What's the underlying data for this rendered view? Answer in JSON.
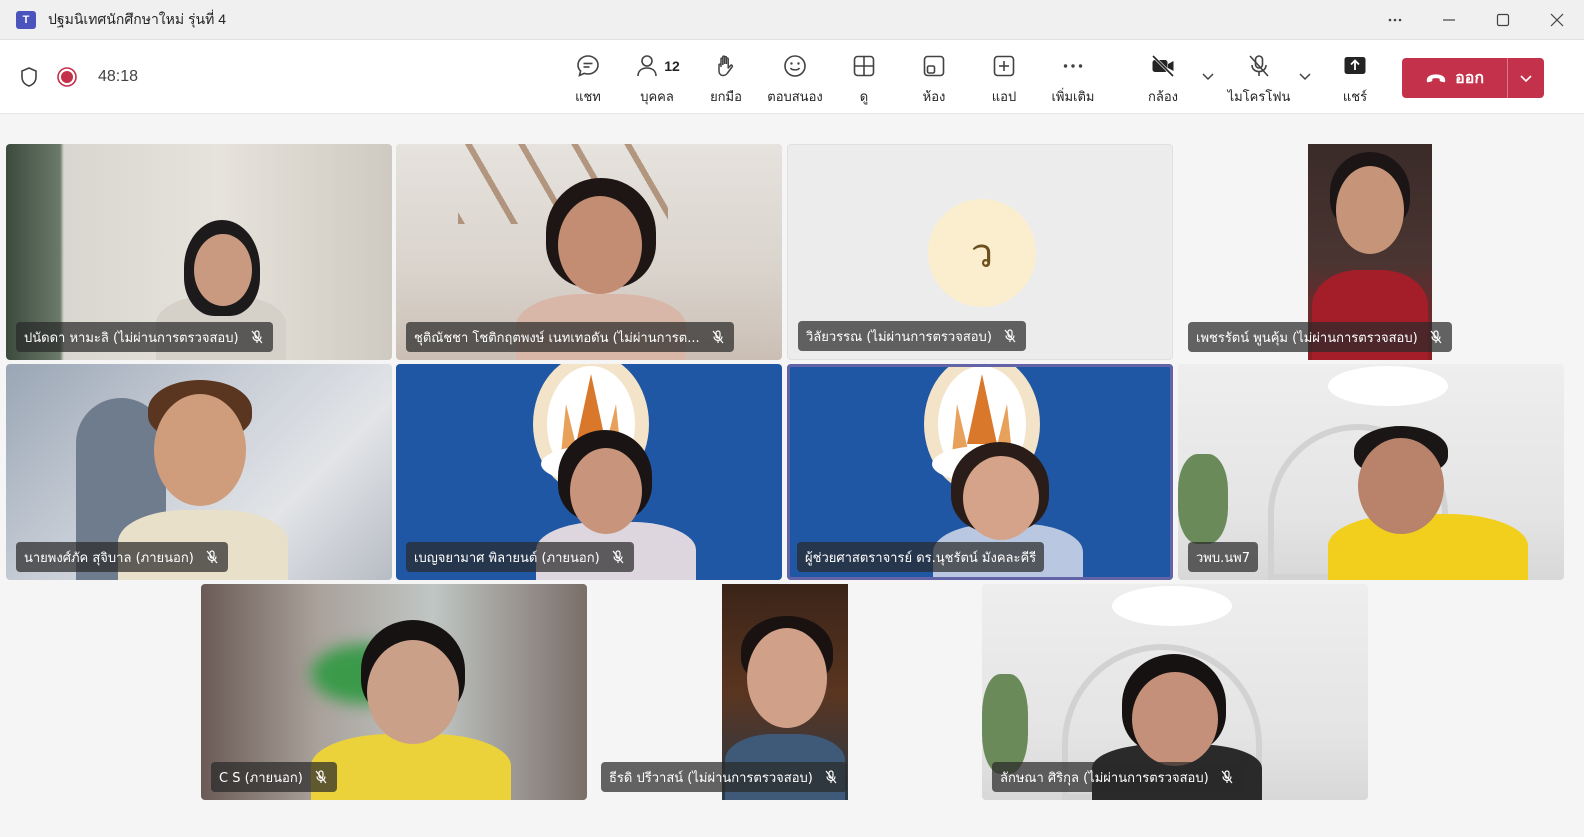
{
  "window": {
    "logo_text": "T",
    "title": "ปฐมนิเทศนักศึกษาใหม่ รุ่นที่ 4"
  },
  "toolbar": {
    "timer": "48:18",
    "chat_label": "แชท",
    "people_label": "บุคคล",
    "people_count": "12",
    "raise_label": "ยกมือ",
    "react_label": "ตอบสนอง",
    "view_label": "ดู",
    "rooms_label": "ห้อง",
    "apps_label": "แอป",
    "more_label": "เพิ่มเติม",
    "camera_label": "กล้อง",
    "mic_label": "ไมโครโฟน",
    "share_label": "แชร์",
    "leave_label": "ออก"
  },
  "participants": [
    {
      "name": "ปนัดดา หามะลิ (ไม่ผ่านการตรวจสอบ)"
    },
    {
      "name": "ชุติณัชชา โชติกฤตพงษ์ เนทเทอดัน (ไม่ผ่านการต..."
    },
    {
      "name": "วิลัยวรรณ (ไม่ผ่านการตรวจสอบ)",
      "initial": "ว"
    },
    {
      "name": "เพชรรัตน์ พูนคุ้ม (ไม่ผ่านการตรวจสอบ)"
    },
    {
      "name": "นายพงศ์ภัค สุจิบาล (ภายนอก)"
    },
    {
      "name": "เบญจยามาศ พิลายนต์ (ภายนอก)"
    },
    {
      "name": "ผู้ช่วยศาสตราจารย์ ดร.นุชรัตน์ มังคละคีรี"
    },
    {
      "name": "วพบ.นพ7"
    },
    {
      "name": "C S (ภายนอก)"
    },
    {
      "name": "ธีรดิ ปรีวาสน์ (ไม่ผ่านการตรวจสอบ)"
    },
    {
      "name": "ลักษณา ศิริกุล (ไม่ผ่านการตรวจสอบ)"
    }
  ],
  "colors": {
    "leave": "#c4314b",
    "active_speaker": "#6264a7",
    "avatar_bg": "#fbeece"
  }
}
